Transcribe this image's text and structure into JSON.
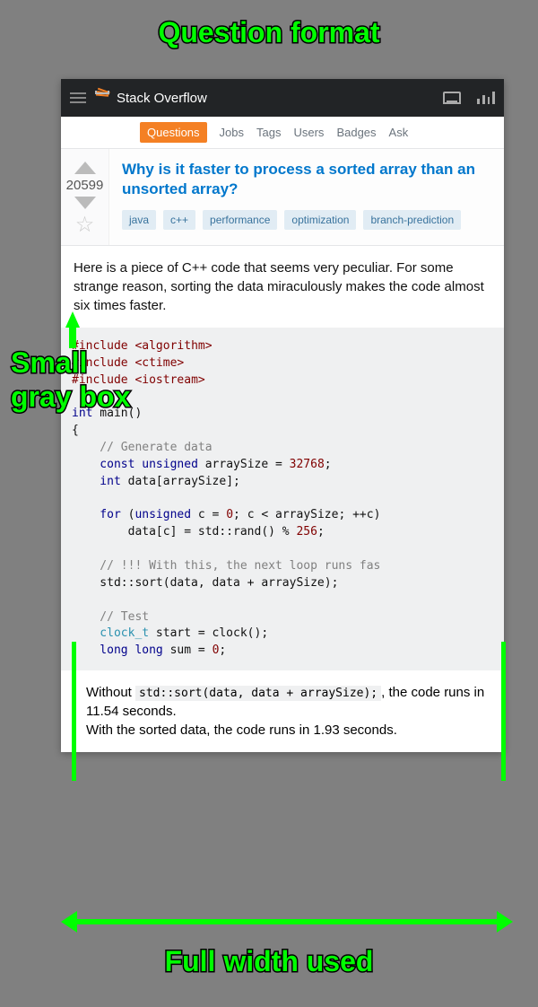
{
  "annotations": {
    "top": "Question format",
    "left1": "Small",
    "left2": "gray box",
    "bottom": "Full width used"
  },
  "topbar": {
    "site": "Stack Overflow"
  },
  "nav": {
    "items": [
      "Questions",
      "Jobs",
      "Tags",
      "Users",
      "Badges",
      "Ask"
    ],
    "active_index": 0
  },
  "question": {
    "score": "20599",
    "title": "Why is it faster to process a sorted array than an unsorted array?",
    "tags": [
      "java",
      "c++",
      "performance",
      "optimization",
      "branch-prediction"
    ],
    "body_intro": "Here is a piece of C++ code that seems very peculiar. For some strange reason, sorting the data miraculously makes the code almost six times faster.",
    "code": {
      "l1a": "#include",
      "l1b": " <algorithm>",
      "l2a": "#include",
      "l2b": " <ctime>",
      "l3a": "#include",
      "l3b": " <iostream>",
      "blank1": "",
      "l4a": "int",
      "l4b": " main()",
      "l5": "{",
      "l6": "    // Generate data",
      "l7a": "    const",
      "l7b": " unsigned",
      "l7c": " arraySize = ",
      "l7d": "32768",
      "l7e": ";",
      "l8a": "    int",
      "l8b": " data[arraySize];",
      "blank2": "",
      "l9a": "    for",
      "l9b": " (",
      "l9c": "unsigned",
      "l9d": " c = ",
      "l9e": "0",
      "l9f": "; c < arraySize; ++c)",
      "l10a": "        data[c] = std::rand() % ",
      "l10b": "256",
      "l10c": ";",
      "blank3": "",
      "l11": "    // !!! With this, the next loop runs fas",
      "l12": "    std::sort(data, data + arraySize);",
      "blank4": "",
      "l13": "    // Test",
      "l14a": "    clock_t",
      "l14b": " start = clock();",
      "l15a": "    long",
      "l15b": " long",
      "l15c": " sum = ",
      "l15d": "0",
      "l15e": ";"
    },
    "results": {
      "r1a": "Without ",
      "r1code": "std::sort(data, data + arraySize);",
      "r1b": ", the code runs in 11.54 seconds.",
      "r2": "With the sorted data, the code runs in 1.93 seconds."
    }
  }
}
